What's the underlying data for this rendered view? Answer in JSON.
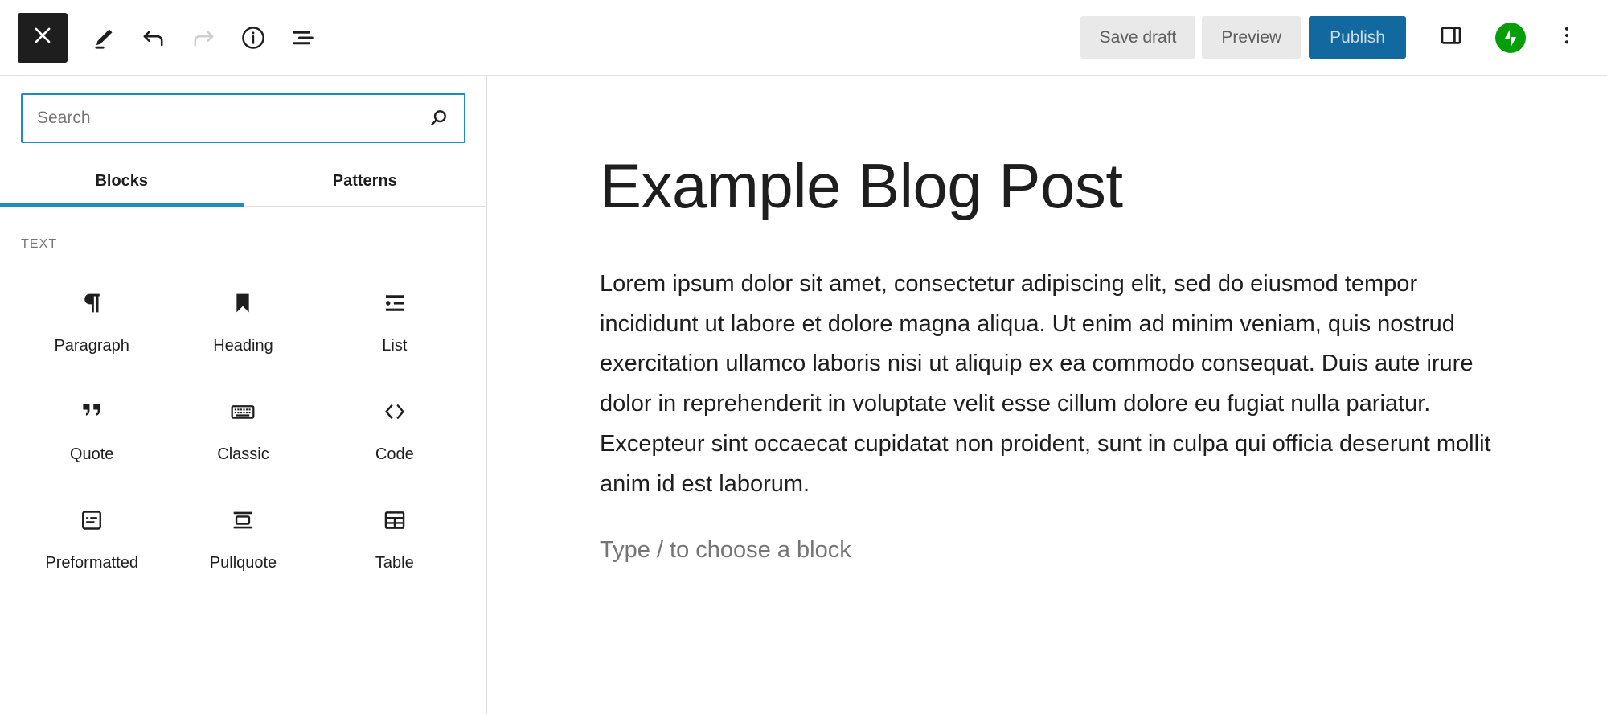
{
  "header": {
    "left_icons": [
      {
        "name": "close-icon",
        "label": "Close"
      },
      {
        "name": "edit-pencil-icon",
        "label": "Edit"
      },
      {
        "name": "undo-icon",
        "label": "Undo"
      },
      {
        "name": "redo-icon",
        "label": "Redo"
      },
      {
        "name": "info-icon",
        "label": "Details"
      },
      {
        "name": "list-view-icon",
        "label": "List View"
      }
    ],
    "save_draft_label": "Save draft",
    "preview_label": "Preview",
    "publish_label": "Publish",
    "settings_icon": "sidebar-panel-icon",
    "jetpack_icon": "jetpack-icon",
    "more_icon": "more-options-icon",
    "publish_bg": "#12699f",
    "jetpack_green": "#069e08"
  },
  "inserter": {
    "search": {
      "placeholder": "Search",
      "value": "",
      "icon": "search-icon",
      "border_color": "#1e8cbe"
    },
    "tabs": [
      {
        "label": "Blocks",
        "active": true
      },
      {
        "label": "Patterns",
        "active": false
      }
    ],
    "category_label": "TEXT",
    "blocks": [
      {
        "label": "Paragraph",
        "icon": "paragraph-pilcrow-icon"
      },
      {
        "label": "Heading",
        "icon": "heading-bookmark-icon"
      },
      {
        "label": "List",
        "icon": "list-bullet-icon"
      },
      {
        "label": "Quote",
        "icon": "quote-marks-icon"
      },
      {
        "label": "Classic",
        "icon": "classic-keyboard-icon"
      },
      {
        "label": "Code",
        "icon": "code-angle-brackets-icon"
      },
      {
        "label": "Preformatted",
        "icon": "preformatted-box-icon"
      },
      {
        "label": "Pullquote",
        "icon": "pullquote-lines-icon"
      },
      {
        "label": "Table",
        "icon": "table-grid-icon"
      }
    ]
  },
  "editor": {
    "title": "Example Blog Post",
    "paragraph": "Lorem ipsum dolor sit amet, consectetur adipiscing elit, sed do eiusmod tempor incididunt ut labore et dolore magna aliqua. Ut enim ad minim veniam, quis nostrud exercitation ullamco laboris nisi ut aliquip ex ea commodo consequat. Duis aute irure dolor in reprehenderit in voluptate velit esse cillum dolore eu fugiat nulla pariatur. Excepteur sint occaecat cupidatat non proident, sunt in culpa qui officia deserunt mollit anim id est laborum.",
    "empty_block_placeholder": "Type / to choose a block"
  }
}
